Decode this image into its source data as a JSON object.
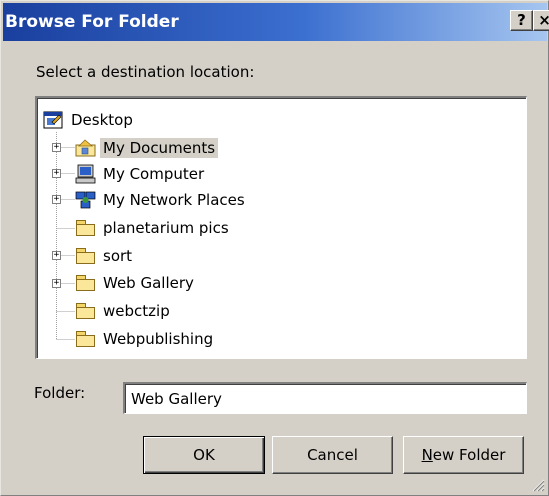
{
  "window": {
    "title": "Browse For Folder",
    "help_label": "?",
    "close_label": "×"
  },
  "prompt": "Select a destination location:",
  "tree": {
    "root": {
      "label": "Desktop",
      "icon": "desktop-icon"
    },
    "items": [
      {
        "label": "My Documents",
        "icon": "my-documents-icon",
        "expandable": true,
        "selected": true
      },
      {
        "label": "My Computer",
        "icon": "my-computer-icon",
        "expandable": true,
        "selected": false
      },
      {
        "label": "My Network Places",
        "icon": "network-places-icon",
        "expandable": true,
        "selected": false
      },
      {
        "label": "planetarium pics",
        "icon": "folder-icon",
        "expandable": false,
        "selected": false
      },
      {
        "label": "sort",
        "icon": "folder-icon",
        "expandable": true,
        "selected": false
      },
      {
        "label": "Web Gallery",
        "icon": "folder-icon",
        "expandable": true,
        "selected": false
      },
      {
        "label": "webctzip",
        "icon": "folder-icon",
        "expandable": false,
        "selected": false
      },
      {
        "label": "Webpublishing",
        "icon": "folder-icon",
        "expandable": false,
        "selected": false
      }
    ]
  },
  "folder": {
    "label": "Folder:",
    "value": "Web Gallery"
  },
  "buttons": {
    "ok": "OK",
    "cancel": "Cancel",
    "new_folder_mnemonic": "N",
    "new_folder_rest": "ew Folder"
  },
  "colors": {
    "titlebar_start": "#1a3f9e",
    "titlebar_end": "#a6c6f0",
    "face": "#d4d0c8",
    "folder_yellow": "#fbe79a"
  }
}
